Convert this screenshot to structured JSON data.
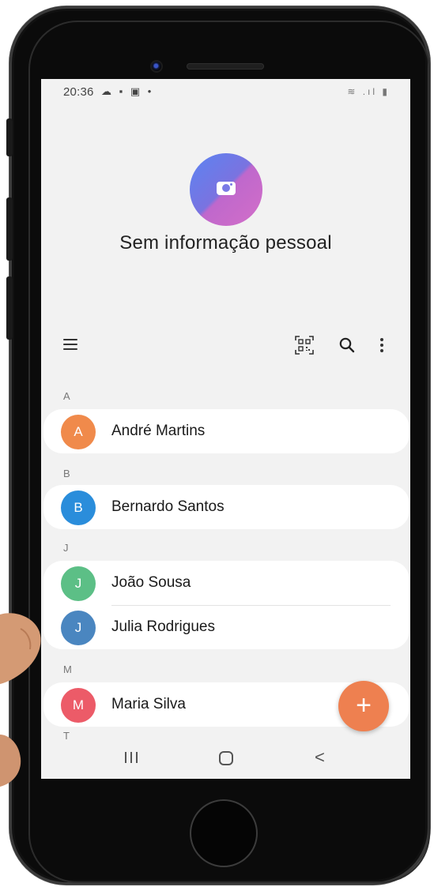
{
  "status_bar": {
    "time": "20:36",
    "left_icons": "☁ ▪ ▣ •",
    "right_icons": "≋ .ıl ▮"
  },
  "profile": {
    "name": "Sem informação pessoal",
    "avatar_icon": "camera-icon"
  },
  "toolbar": {
    "menu_icon": "hamburger-menu-icon",
    "qr_icon": "qr-code-icon",
    "search_icon": "search-icon",
    "more_icon": "more-vertical-icon"
  },
  "sections": [
    {
      "letter": "A",
      "contacts": [
        {
          "initial": "A",
          "name": "André Martins",
          "color": "#f08a4b"
        }
      ]
    },
    {
      "letter": "B",
      "contacts": [
        {
          "initial": "B",
          "name": "Bernardo Santos",
          "color": "#2a8ddb"
        }
      ]
    },
    {
      "letter": "J",
      "contacts": [
        {
          "initial": "J",
          "name": "João Sousa",
          "color": "#5cbf86"
        },
        {
          "initial": "J",
          "name": "Julia Rodrigues",
          "color": "#4a86c0"
        }
      ]
    },
    {
      "letter": "M",
      "contacts": [
        {
          "initial": "M",
          "name": "Maria Silva",
          "color": "#ec5b68"
        }
      ]
    },
    {
      "letter": "T",
      "contacts": []
    }
  ],
  "fab": {
    "label": "+",
    "color": "#ee8050"
  },
  "nav": {
    "recent_icon": "recent-apps-icon",
    "home_icon": "home-icon",
    "back_label": "<"
  }
}
